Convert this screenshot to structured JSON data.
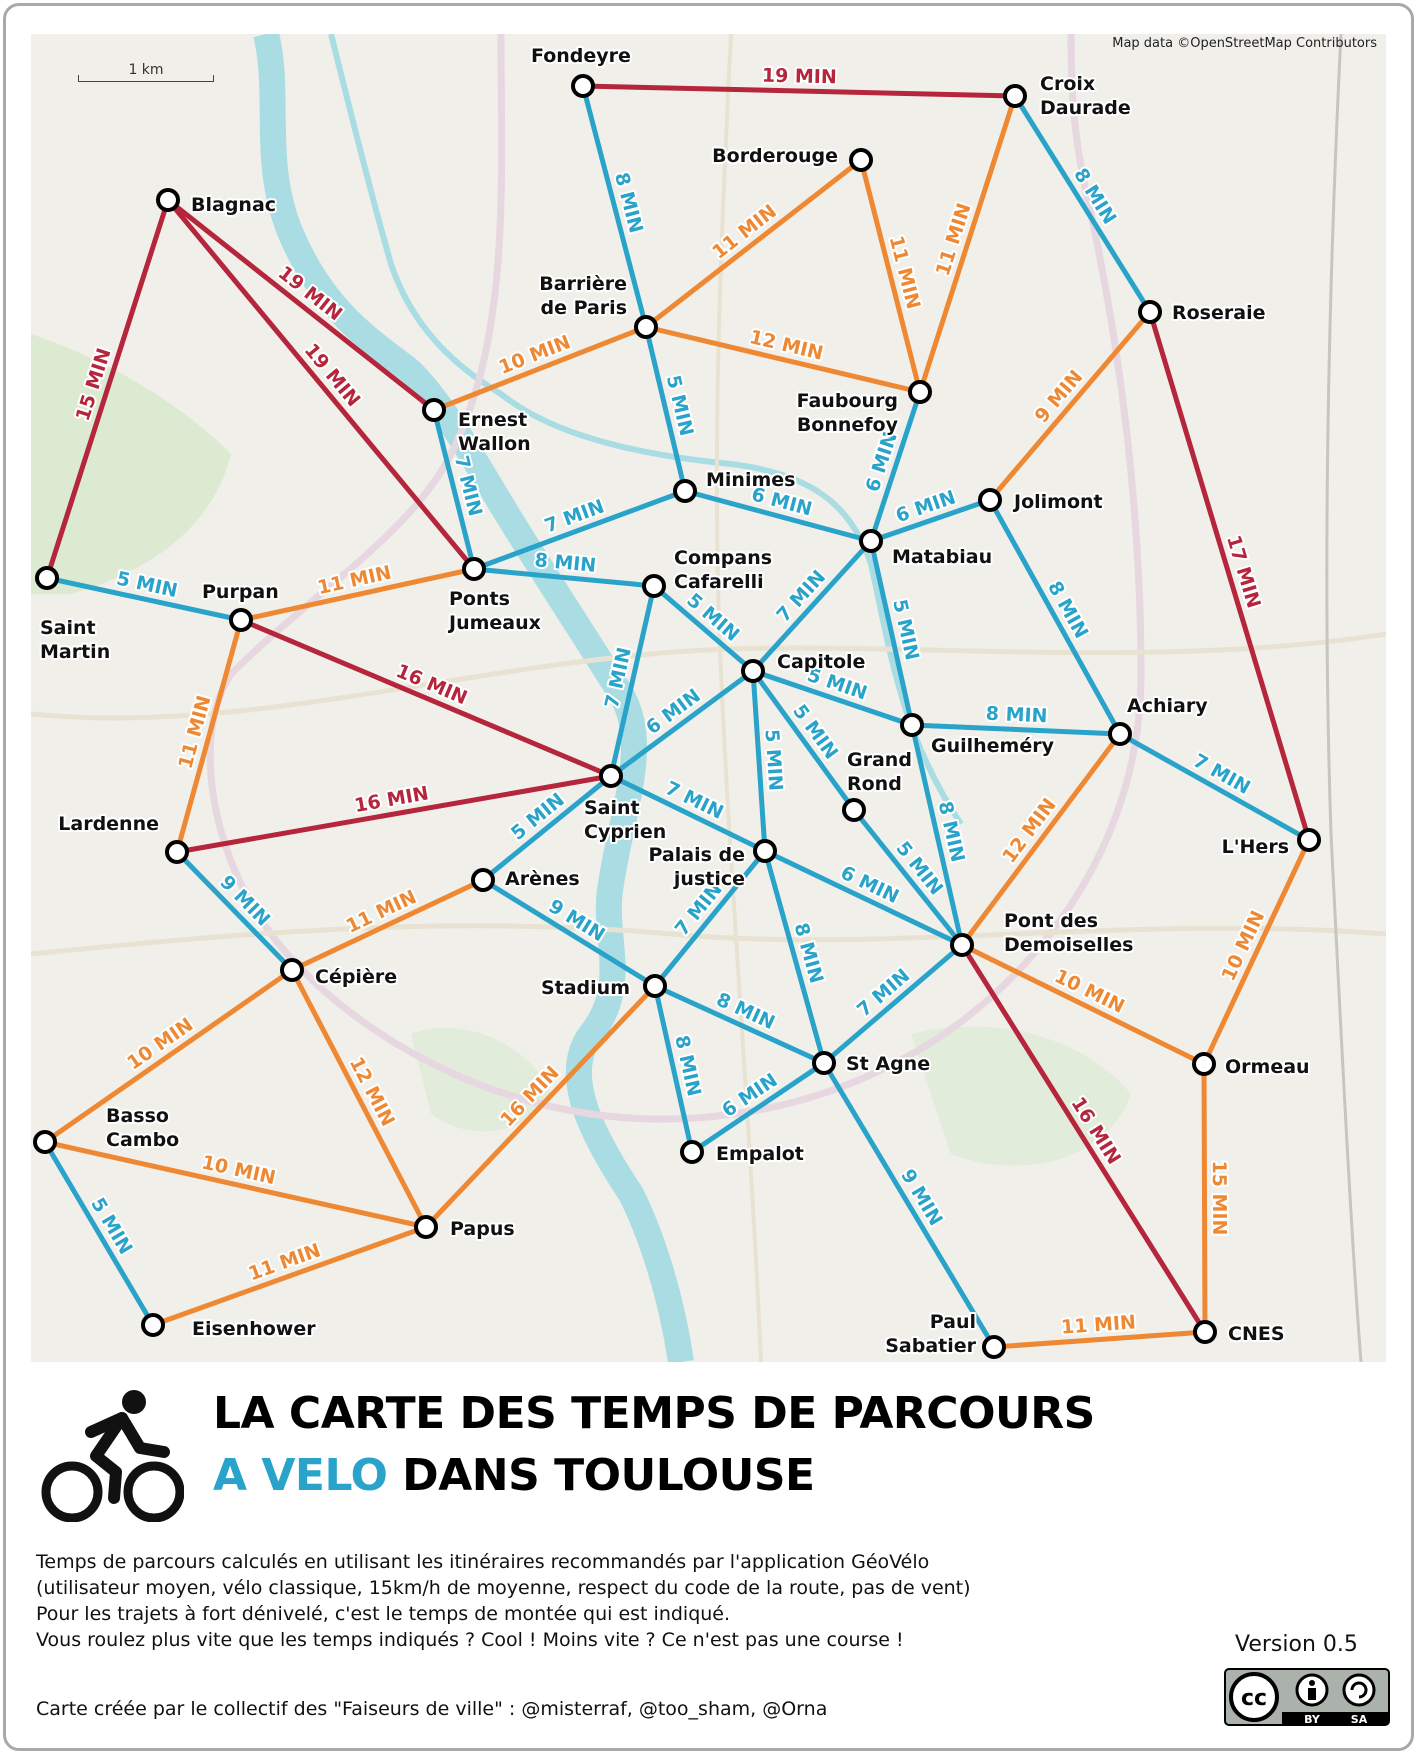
{
  "map": {
    "attribution": "Map data ©OpenStreetMap Contributors",
    "scale_label": "1 km",
    "line_colors": {
      "blue": "#29a3c9",
      "orange": "#ee8833",
      "red": "#b5253b"
    },
    "stations": [
      {
        "id": "fondeyre",
        "name_lines": [
          "Fondeyre"
        ]
      },
      {
        "id": "croix-daurade",
        "name_lines": [
          "Croix",
          "Daurade"
        ]
      },
      {
        "id": "borderouge",
        "name_lines": [
          "Borderouge"
        ]
      },
      {
        "id": "blagnac",
        "name_lines": [
          "Blagnac"
        ]
      },
      {
        "id": "barriere-de-paris",
        "name_lines": [
          "Barrière",
          "de Paris"
        ]
      },
      {
        "id": "roseraie",
        "name_lines": [
          "Roseraie"
        ]
      },
      {
        "id": "ernest-wallon",
        "name_lines": [
          "Ernest",
          "Wallon"
        ]
      },
      {
        "id": "faubourg-bonnefoy",
        "name_lines": [
          "Faubourg",
          "Bonnefoy"
        ]
      },
      {
        "id": "minimes",
        "name_lines": [
          "Minimes"
        ]
      },
      {
        "id": "jolimont",
        "name_lines": [
          "Jolimont"
        ]
      },
      {
        "id": "matabiau",
        "name_lines": [
          "Matabiau"
        ]
      },
      {
        "id": "saint-martin",
        "name_lines": [
          "Saint",
          "Martin"
        ]
      },
      {
        "id": "purpan",
        "name_lines": [
          "Purpan"
        ]
      },
      {
        "id": "ponts-jumeaux",
        "name_lines": [
          "Ponts",
          "Jumeaux"
        ]
      },
      {
        "id": "compans-cafarelli",
        "name_lines": [
          "Compans",
          "Cafarelli"
        ]
      },
      {
        "id": "capitole",
        "name_lines": [
          "Capitole"
        ]
      },
      {
        "id": "guilhemery",
        "name_lines": [
          "Guilheméry"
        ]
      },
      {
        "id": "achiary",
        "name_lines": [
          "Achiary"
        ]
      },
      {
        "id": "grand-rond",
        "name_lines": [
          "Grand",
          "Rond"
        ]
      },
      {
        "id": "saint-cyprien",
        "name_lines": [
          "Saint",
          "Cyprien"
        ]
      },
      {
        "id": "lardenne",
        "name_lines": [
          "Lardenne"
        ]
      },
      {
        "id": "l-hers",
        "name_lines": [
          "L'Hers"
        ]
      },
      {
        "id": "palais-de-justice",
        "name_lines": [
          "Palais de",
          "justice"
        ]
      },
      {
        "id": "arenes",
        "name_lines": [
          "Arènes"
        ]
      },
      {
        "id": "pont-des-demoiselles",
        "name_lines": [
          "Pont des",
          "Demoiselles"
        ]
      },
      {
        "id": "cepiere",
        "name_lines": [
          "Cépière"
        ]
      },
      {
        "id": "stadium",
        "name_lines": [
          "Stadium"
        ]
      },
      {
        "id": "st-agne",
        "name_lines": [
          "St Agne"
        ]
      },
      {
        "id": "ormeau",
        "name_lines": [
          "Ormeau"
        ]
      },
      {
        "id": "basso-cambo",
        "name_lines": [
          "Basso",
          "Cambo"
        ]
      },
      {
        "id": "empalot",
        "name_lines": [
          "Empalot"
        ]
      },
      {
        "id": "papus",
        "name_lines": [
          "Papus"
        ]
      },
      {
        "id": "eisenhower",
        "name_lines": [
          "Eisenhower"
        ]
      },
      {
        "id": "paul-sabatier",
        "name_lines": [
          "Paul",
          "Sabatier"
        ]
      },
      {
        "id": "cnes",
        "name_lines": [
          "CNES"
        ]
      }
    ],
    "routes": [
      {
        "from": "fondeyre",
        "to": "croix-daurade",
        "time": "19 MIN",
        "color": "red"
      },
      {
        "from": "fondeyre",
        "to": "barriere-de-paris",
        "time": "8 MIN",
        "color": "blue"
      },
      {
        "from": "croix-daurade",
        "to": "roseraie",
        "time": "8 MIN",
        "color": "blue"
      },
      {
        "from": "croix-daurade",
        "to": "faubourg-bonnefoy",
        "time": "11 MIN",
        "color": "orange"
      },
      {
        "from": "borderouge",
        "to": "barriere-de-paris",
        "time": "11 MIN",
        "color": "orange"
      },
      {
        "from": "borderouge",
        "to": "faubourg-bonnefoy",
        "time": "11 MIN",
        "color": "orange"
      },
      {
        "from": "blagnac",
        "to": "ernest-wallon",
        "time": "19 MIN",
        "color": "red"
      },
      {
        "from": "blagnac",
        "to": "ponts-jumeaux",
        "time": "19 MIN",
        "color": "red"
      },
      {
        "from": "blagnac",
        "to": "saint-martin",
        "time": "15 MIN",
        "color": "red"
      },
      {
        "from": "barriere-de-paris",
        "to": "ernest-wallon",
        "time": "10 MIN",
        "color": "orange"
      },
      {
        "from": "barriere-de-paris",
        "to": "faubourg-bonnefoy",
        "time": "12 MIN",
        "color": "orange"
      },
      {
        "from": "barriere-de-paris",
        "to": "minimes",
        "time": "5 MIN",
        "color": "blue"
      },
      {
        "from": "roseraie",
        "to": "jolimont",
        "time": "9 MIN",
        "color": "orange"
      },
      {
        "from": "roseraie",
        "to": "l-hers",
        "time": "17 MIN",
        "color": "red"
      },
      {
        "from": "ernest-wallon",
        "to": "ponts-jumeaux",
        "time": "7 MIN",
        "color": "blue"
      },
      {
        "from": "faubourg-bonnefoy",
        "to": "matabiau",
        "time": "6 MIN",
        "color": "blue"
      },
      {
        "from": "minimes",
        "to": "ponts-jumeaux",
        "time": "7 MIN",
        "color": "blue"
      },
      {
        "from": "minimes",
        "to": "matabiau",
        "time": "6 MIN",
        "color": "blue"
      },
      {
        "from": "jolimont",
        "to": "matabiau",
        "time": "6 MIN",
        "color": "blue"
      },
      {
        "from": "jolimont",
        "to": "achiary",
        "time": "8 MIN",
        "color": "blue"
      },
      {
        "from": "matabiau",
        "to": "capitole",
        "time": "7 MIN",
        "color": "blue"
      },
      {
        "from": "matabiau",
        "to": "guilhemery",
        "time": "5 MIN",
        "color": "blue"
      },
      {
        "from": "saint-martin",
        "to": "purpan",
        "time": "5 MIN",
        "color": "blue"
      },
      {
        "from": "purpan",
        "to": "ponts-jumeaux",
        "time": "11 MIN",
        "color": "orange"
      },
      {
        "from": "purpan",
        "to": "saint-cyprien",
        "time": "16 MIN",
        "color": "red"
      },
      {
        "from": "purpan",
        "to": "lardenne",
        "time": "11 MIN",
        "color": "orange"
      },
      {
        "from": "ponts-jumeaux",
        "to": "compans-cafarelli",
        "time": "8 MIN",
        "color": "blue"
      },
      {
        "from": "compans-cafarelli",
        "to": "capitole",
        "time": "5 MIN",
        "color": "blue"
      },
      {
        "from": "compans-cafarelli",
        "to": "saint-cyprien",
        "time": "7 MIN",
        "color": "blue"
      },
      {
        "from": "capitole",
        "to": "guilhemery",
        "time": "5 MIN",
        "color": "blue"
      },
      {
        "from": "capitole",
        "to": "saint-cyprien",
        "time": "6 MIN",
        "color": "blue"
      },
      {
        "from": "capitole",
        "to": "palais-de-justice",
        "time": "5 MIN",
        "color": "blue"
      },
      {
        "from": "capitole",
        "to": "grand-rond",
        "time": "5 MIN",
        "color": "blue"
      },
      {
        "from": "guilhemery",
        "to": "achiary",
        "time": "8 MIN",
        "color": "blue"
      },
      {
        "from": "guilhemery",
        "to": "pont-des-demoiselles",
        "time": "8 MIN",
        "color": "blue"
      },
      {
        "from": "achiary",
        "to": "l-hers",
        "time": "7 MIN",
        "color": "blue"
      },
      {
        "from": "achiary",
        "to": "pont-des-demoiselles",
        "time": "12 MIN",
        "color": "orange"
      },
      {
        "from": "grand-rond",
        "to": "pont-des-demoiselles",
        "time": "5 MIN",
        "color": "blue"
      },
      {
        "from": "saint-cyprien",
        "to": "lardenne",
        "time": "16 MIN",
        "color": "red"
      },
      {
        "from": "saint-cyprien",
        "to": "arenes",
        "time": "5 MIN",
        "color": "blue"
      },
      {
        "from": "saint-cyprien",
        "to": "palais-de-justice",
        "time": "7 MIN",
        "color": "blue"
      },
      {
        "from": "lardenne",
        "to": "cepiere",
        "time": "9 MIN",
        "color": "blue"
      },
      {
        "from": "l-hers",
        "to": "ormeau",
        "time": "10 MIN",
        "color": "orange"
      },
      {
        "from": "palais-de-justice",
        "to": "pont-des-demoiselles",
        "time": "6 MIN",
        "color": "blue"
      },
      {
        "from": "palais-de-justice",
        "to": "stadium",
        "time": "7 MIN",
        "color": "blue"
      },
      {
        "from": "palais-de-justice",
        "to": "st-agne",
        "time": "8 MIN",
        "color": "blue"
      },
      {
        "from": "arenes",
        "to": "cepiere",
        "time": "11 MIN",
        "color": "orange"
      },
      {
        "from": "arenes",
        "to": "stadium",
        "time": "9 MIN",
        "color": "blue"
      },
      {
        "from": "pont-des-demoiselles",
        "to": "st-agne",
        "time": "7 MIN",
        "color": "blue"
      },
      {
        "from": "pont-des-demoiselles",
        "to": "ormeau",
        "time": "10 MIN",
        "color": "orange"
      },
      {
        "from": "pont-des-demoiselles",
        "to": "cnes",
        "time": "16 MIN",
        "color": "red"
      },
      {
        "from": "cepiere",
        "to": "basso-cambo",
        "time": "10 MIN",
        "color": "orange"
      },
      {
        "from": "cepiere",
        "to": "papus",
        "time": "12 MIN",
        "color": "orange"
      },
      {
        "from": "stadium",
        "to": "st-agne",
        "time": "8 MIN",
        "color": "blue"
      },
      {
        "from": "stadium",
        "to": "empalot",
        "time": "8 MIN",
        "color": "blue"
      },
      {
        "from": "stadium",
        "to": "papus",
        "time": "16 MIN",
        "color": "orange"
      },
      {
        "from": "st-agne",
        "to": "empalot",
        "time": "6 MIN",
        "color": "blue"
      },
      {
        "from": "st-agne",
        "to": "paul-sabatier",
        "time": "9 MIN",
        "color": "blue"
      },
      {
        "from": "ormeau",
        "to": "cnes",
        "time": "15 MIN",
        "color": "orange"
      },
      {
        "from": "basso-cambo",
        "to": "papus",
        "time": "10 MIN",
        "color": "orange"
      },
      {
        "from": "basso-cambo",
        "to": "eisenhower",
        "time": "5 MIN",
        "color": "blue"
      },
      {
        "from": "papus",
        "to": "eisenhower",
        "time": "11 MIN",
        "color": "orange"
      },
      {
        "from": "paul-sabatier",
        "to": "cnes",
        "time": "11 MIN",
        "color": "orange"
      }
    ]
  },
  "title": {
    "line1": "LA CARTE DES TEMPS DE PARCOURS",
    "line2_accent": "A VELO",
    "line2_rest": " DANS TOULOUSE",
    "accent_color": "#29a3c9"
  },
  "description": [
    "Temps de parcours calculés en utilisant les itinéraires recommandés par l'application GéoVélo",
    "(utilisateur moyen, vélo classique, 15km/h de moyenne, respect du code de la route, pas de vent)",
    "Pour les trajets à fort dénivelé, c'est le temps de montée qui est indiqué.",
    "Vous roulez plus vite que les temps indiqués ? Cool ! Moins vite ? Ce n'est pas une course !"
  ],
  "credits": "Carte créée par le collectif des \"Faiseurs de ville\" : @misterraf, @too_sham, @Orna",
  "version": "Version 0.5",
  "license": {
    "cc": "cc",
    "by": "BY",
    "sa": "SA"
  },
  "bike_icon": "bicycle-rider-icon"
}
